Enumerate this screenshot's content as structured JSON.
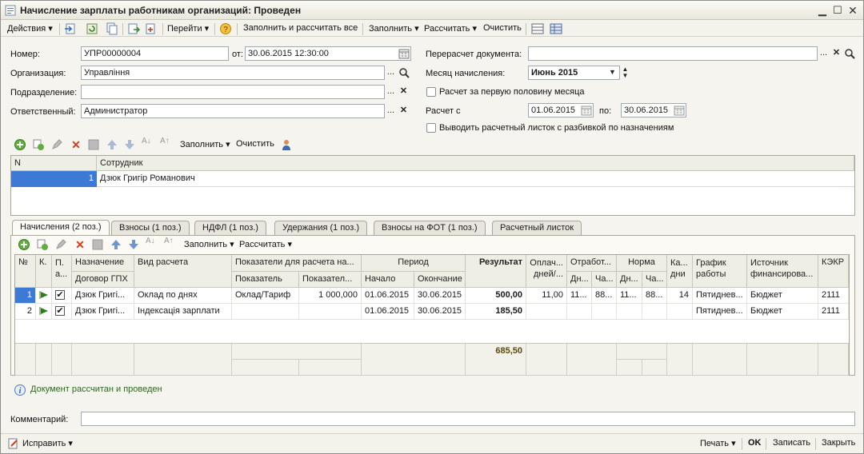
{
  "window": {
    "title": "Начисление зарплаты работникам организаций: Проведен"
  },
  "toolbar": {
    "actions": "Действия",
    "goto": "Перейти",
    "fill_calc_all": "Заполнить и рассчитать все",
    "fill": "Заполнить",
    "calculate": "Рассчитать",
    "clear": "Очистить"
  },
  "form": {
    "number_label": "Номер:",
    "number_value": "УПР00000004",
    "date_label": "от:",
    "date_value": "30.06.2015 12:30:00",
    "org_label": "Организация:",
    "org_value": "Управління",
    "dept_label": "Подразделение:",
    "dept_value": "",
    "resp_label": "Ответственный:",
    "resp_value": "Администратор",
    "recalc_label": "Перерасчет документа:",
    "recalc_value": "",
    "month_label": "Месяц начисления:",
    "month_value": "Июнь 2015",
    "first_half_label": "Расчет за первую половину месяца",
    "calc_from_label": "Расчет с",
    "calc_from_value": "01.06.2015",
    "calc_to_label": "по:",
    "calc_to_value": "30.06.2015",
    "payslip_label": "Выводить расчетный листок с разбивкой по назначениям"
  },
  "employees": {
    "fill": "Заполнить",
    "clear": "Очистить",
    "col_n": "N",
    "col_employee": "Сотрудник",
    "rows": [
      {
        "n": "1",
        "name": "Дзюк Григір Романович"
      }
    ]
  },
  "tabs": [
    {
      "label": "Начисления (2 поз.)"
    },
    {
      "label": "Взносы (1 поз.)"
    },
    {
      "label": "НДФЛ (1 поз.)"
    },
    {
      "label": "Удержания (1 поз.)"
    },
    {
      "label": "Взносы на ФОТ (1 поз.)"
    },
    {
      "label": "Расчетный листок"
    }
  ],
  "accruals": {
    "fill": "Заполнить",
    "calculate": "Рассчитать",
    "headers": {
      "n": "№",
      "k": "К.",
      "p": "П.",
      "pa": "а...",
      "assignment": "Назначение",
      "contract": "Договор ГПХ",
      "calc_type": "Вид расчета",
      "indicators": "Показатели для расчета на...",
      "indicator": "Показатель",
      "indicator_val": "Показател...",
      "period": "Период",
      "start": "Начало",
      "end": "Окончание",
      "result": "Результат",
      "paid1": "Оплач...",
      "paid2": "дней/...",
      "worked": "Отработ...",
      "norm": "Норма",
      "days_short": "Дн...",
      "hours_short": "Ча...",
      "ka1": "Ка...",
      "ka2": "дни",
      "schedule1": "График",
      "schedule2": "работы",
      "source1": "Источник",
      "source2": "финансирова...",
      "kekr": "КЭКР"
    },
    "rows": [
      {
        "n": "1",
        "checked": true,
        "assignment": "Дзюк Григі...",
        "calc_type": "Оклад по днях",
        "indicator": "Оклад/Тариф",
        "indicator_val": "1 000,000",
        "start": "01.06.2015",
        "end": "30.06.2015",
        "result": "500,00",
        "paid": "11,00",
        "worked_d": "11...",
        "worked_h": "88...",
        "norm_d": "11...",
        "norm_h": "88...",
        "ka": "14",
        "schedule": "Пятиднев...",
        "source": "Бюджет",
        "kekr": "2111"
      },
      {
        "n": "2",
        "checked": true,
        "assignment": "Дзюк Григі...",
        "calc_type": "Індексація зарплати",
        "indicator": "",
        "indicator_val": "",
        "start": "01.06.2015",
        "end": "30.06.2015",
        "result": "185,50",
        "paid": "",
        "worked_d": "",
        "worked_h": "",
        "norm_d": "",
        "norm_h": "",
        "ka": "",
        "schedule": "Пятиднев...",
        "source": "Бюджет",
        "kekr": "2111"
      }
    ],
    "total": "685,50"
  },
  "status": {
    "message": "Документ рассчитан и проведен"
  },
  "comment": {
    "label": "Комментарий:",
    "value": ""
  },
  "bottom": {
    "fix": "Исправить",
    "print": "Печать",
    "ok": "OK",
    "save": "Записать",
    "close": "Закрыть"
  }
}
